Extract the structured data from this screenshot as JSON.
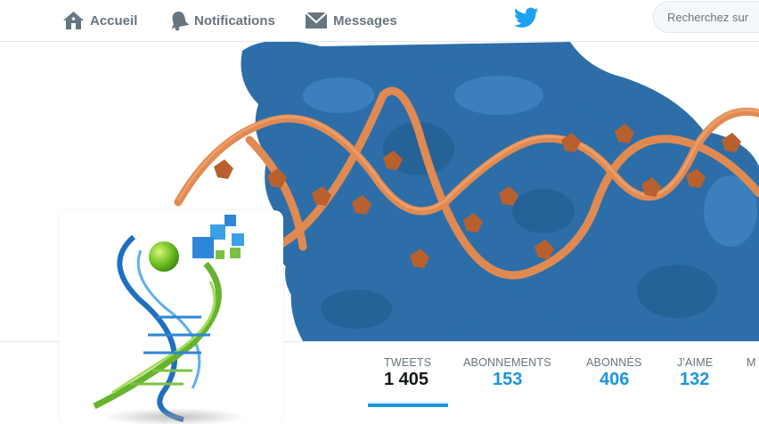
{
  "nav": {
    "home_label": "Accueil",
    "notifications_label": "Notifications",
    "messages_label": "Messages"
  },
  "search": {
    "placeholder": "Recherchez sur"
  },
  "stats": {
    "tweets_label": "TWEETS",
    "tweets_value": "1 405",
    "following_label": "ABONNEMENTS",
    "following_value": "153",
    "followers_label": "ABONNÉS",
    "followers_value": "406",
    "likes_label": "J'AIME",
    "likes_value": "132",
    "more_label": "M"
  },
  "colors": {
    "accent": "#1b95e0",
    "twitter_blue": "#1da1f2",
    "nav_gray": "#66757f",
    "banner_protein": "#2d6ea8",
    "banner_dna": "#e08a52"
  },
  "icons": {
    "home": "home-icon",
    "notifications": "bell-icon",
    "messages": "envelope-icon",
    "logo": "twitter-bird-icon"
  }
}
